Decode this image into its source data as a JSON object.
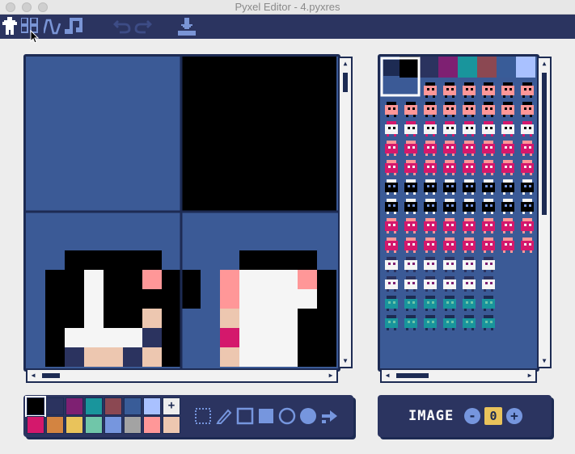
{
  "window": {
    "title": "Pyxel Editor - 4.pyxres"
  },
  "toolbar": {
    "items": [
      {
        "name": "image-editor-icon",
        "active": true
      },
      {
        "name": "tilemap-editor-icon",
        "active": false
      },
      {
        "name": "sound-editor-icon",
        "active": false
      },
      {
        "name": "music-editor-icon",
        "active": false
      },
      {
        "name": "undo-icon",
        "enabled": false
      },
      {
        "name": "redo-icon",
        "enabled": false
      },
      {
        "name": "save-icon",
        "enabled": true
      }
    ]
  },
  "palette": {
    "colors": [
      "#000000",
      "#2b335f",
      "#7e2072",
      "#19959c",
      "#8b4852",
      "#395c98",
      "#a9c1ff",
      "#eeeeee",
      "#d4186c",
      "#d38441",
      "#e9c35b",
      "#70c6a9",
      "#7696de",
      "#a3a3a3",
      "#ff9798",
      "#edc7b0"
    ],
    "selected_index": 0,
    "secondary_index": 7
  },
  "drawing_tools": [
    "select-icon",
    "pencil-icon",
    "rect-outline-icon",
    "rect-filled-icon",
    "circle-outline-icon",
    "circle-filled-icon",
    "bucket-icon"
  ],
  "image_panel": {
    "label": "IMAGE",
    "value": "0",
    "minus": "-",
    "plus": "+"
  },
  "sprite_palette_row": [
    "#000000",
    "#2b335f",
    "#7e2072",
    "#19959c",
    "#8b4852",
    "#395c98",
    "#a9c1ff"
  ]
}
